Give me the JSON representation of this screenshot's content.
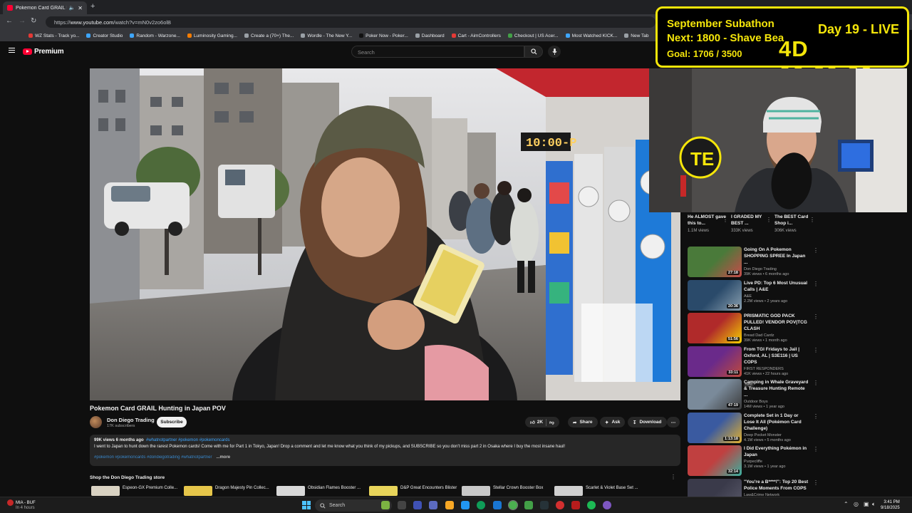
{
  "browser": {
    "tab_title": "Pokemon Card GRAIL Hunti...",
    "url_prefix": "https://",
    "url_host": "www.youtube.com",
    "url_path": "/watch?v=mN0v2zo6olB",
    "bookmarks": [
      {
        "label": "WZ Stats - Track yo...",
        "color": "#e53935"
      },
      {
        "label": "Creator Studio",
        "color": "#3ea6ff"
      },
      {
        "label": "Random - Warzone...",
        "color": "#3ea6ff"
      },
      {
        "label": "Luminosity Gaming...",
        "color": "#f57c00"
      },
      {
        "label": "Create a (70+) The...",
        "color": "#9aa0a6"
      },
      {
        "label": "Wordle - The New Y...",
        "color": "#9aa0a6"
      },
      {
        "label": "Poker Now - Poker...",
        "color": "#111111"
      },
      {
        "label": "Dashboard",
        "color": "#9aa0a6"
      },
      {
        "label": "Cart - AimControllers",
        "color": "#e53935"
      },
      {
        "label": "Checkout | US Acer...",
        "color": "#43a047"
      },
      {
        "label": "Most Watched KICK...",
        "color": "#3ea6ff"
      },
      {
        "label": "New Tab",
        "color": "#9aa0a6"
      },
      {
        "label": "Shopify Co...",
        "color": "#43a047"
      }
    ]
  },
  "header": {
    "logo_text": "Premium",
    "search_placeholder": "Search"
  },
  "video": {
    "title": "Pokemon Card GRAIL Hunting in Japan POV",
    "channel": "Don Diego Trading",
    "subscribers": "17K subscribers",
    "subscribe_label": "Subscribe",
    "likes": "2K",
    "share_label": "Share",
    "ask_label": "Ask",
    "download_label": "Download",
    "overlay_sign": "10:00-P"
  },
  "description": {
    "meta": "99K views  6 months ago",
    "hashtags": "#whatnotpartner #pokemon #pokemoncards",
    "body": "I went to Japan to hunt down the rarest Pokemon cards! Come with me for Part 1 in Tokyo, Japan! Drop a comment and let me know what you think of my pickups, and SUBSCRIBE so you don't miss part 2 in Osaka where I buy the most insane haul!",
    "hashtags2": "#pokemon #pokemoncards #dondiegotrading #whatnotpartner",
    "more": "...more"
  },
  "shop": {
    "title": "Shop the Don Diego Trading store",
    "items": [
      {
        "name": "Espeon-GX Premium Colle...",
        "color": "#d9d2c2"
      },
      {
        "name": "Dragon Majesty Pin Collec...",
        "color": "#e6c64a"
      },
      {
        "name": "Obsidian Flames Booster ...",
        "color": "#d8d8d8"
      },
      {
        "name": "D&P Great Encounters Blister",
        "color": "#e8d45a"
      },
      {
        "name": "Stellar Crown Booster Box",
        "color": "#c8c8c8"
      },
      {
        "name": "Scarlet & Violet Base Set ...",
        "color": "#d0d0d0"
      }
    ]
  },
  "overlay": {
    "line1": "September Subathon",
    "line2": "Next: 1800 - Shave Bea",
    "line3": "Goal: 1706 / 3500",
    "day": "Day 19 - LIVE",
    "countdown": "4D 06:20:26"
  },
  "shorts": [
    {
      "title": "He ALMOST gave this to...",
      "views": "1.1M views"
    },
    {
      "title": "I GRADED MY BEST ...",
      "views": "333K views"
    },
    {
      "title": "The BEST Card Shop i...",
      "views": "306K views"
    }
  ],
  "recommendations": [
    {
      "title": "Going On A Pokemon SHOPPING SPREE In Japan ...",
      "channel": "Don Diego Trading",
      "views": "39K views • 6 months ago",
      "duration": "27:18",
      "badge": "",
      "color1": "#4a7a3a",
      "color2": "#c94a4a"
    },
    {
      "title": "Live PD: Top 6 Most Unusual Calls | A&E",
      "channel": "A&E",
      "views": "2.2M views • 2 years ago",
      "duration": "20:36",
      "badge": "",
      "color1": "#2a4a6a",
      "color2": "#8aa0b0"
    },
    {
      "title": "PRISMATIC GOD PACK PULLED! VENDOR POV|TCG CLASH",
      "channel": "Bread Dad Cardz",
      "views": "39K views • 1 month ago",
      "duration": "51:56",
      "badge": "",
      "color1": "#b02a2a",
      "color2": "#f5d000"
    },
    {
      "title": "From TGI Fridays to Jail | Oxford, AL | S3E116 | US COPS",
      "channel": "FIRST RESPONDERS",
      "views": "41K views • 22 hours ago",
      "duration": "33:11",
      "badge": "New",
      "color1": "#6a2a8a",
      "color2": "#c04a3a"
    },
    {
      "title": "Camping in Whale Graveyard & Treasure Hunting Remote ...",
      "channel": "Outdoor Boys",
      "views": "14M views • 1 year ago",
      "duration": "47:19",
      "badge": "",
      "color1": "#7a8a9a",
      "color2": "#3a3a3a"
    },
    {
      "title": "Complete Set in 1 Day or Lose It All (Pokémon Card Challenge)",
      "channel": "Deep Pocket Monster",
      "views": "4.1M views • 5 months ago",
      "duration": "1:13:18",
      "badge": "",
      "color1": "#3a5aa0",
      "color2": "#e0b030"
    },
    {
      "title": "I Did Everything Pokémon in Japan",
      "channel": "Purpecliffe",
      "views": "3.1M views • 1 year ago",
      "duration": "32:14",
      "badge": "",
      "color1": "#c04040",
      "color2": "#3ab0a0"
    },
    {
      "title": "\"You're a B****!\": Top 20 Best Police Moments From COPS",
      "channel": "Law&Crime Network",
      "views": "",
      "duration": "",
      "badge": "",
      "color1": "#3a3a4a",
      "color2": "#5a5a6a"
    }
  ],
  "taskbar": {
    "weather_title": "MIA - BUF",
    "weather_sub": "In 4 hours",
    "search_placeholder": "Search",
    "time": "3:41 PM",
    "date": "9/18/2025"
  }
}
